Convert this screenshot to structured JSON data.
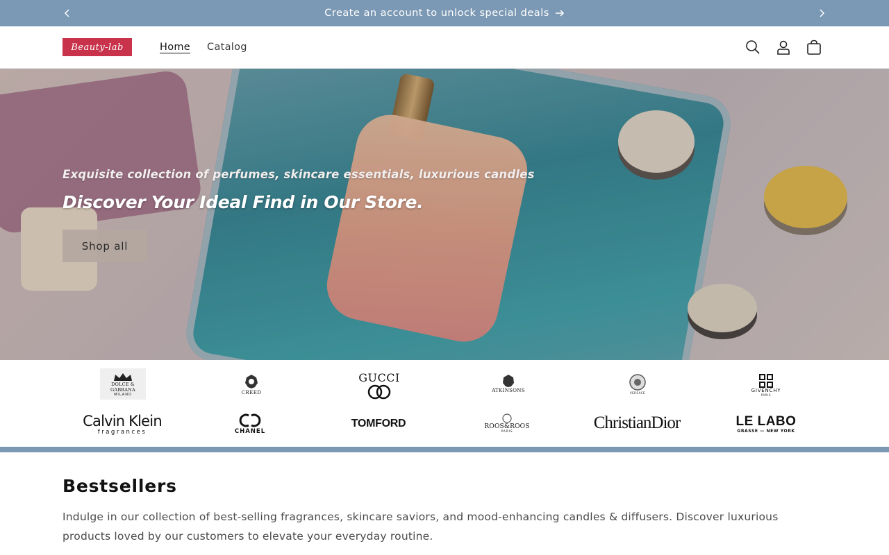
{
  "announcement": {
    "text": "Create an account to unlock special deals"
  },
  "header": {
    "logo_text": "Beauty-lab",
    "nav": [
      {
        "label": "Home",
        "active": true
      },
      {
        "label": "Catalog",
        "active": false
      }
    ],
    "icons": [
      "search-icon",
      "account-icon",
      "cart-icon"
    ]
  },
  "hero": {
    "subtitle": "Exquisite collection of perfumes, skincare essentials, luxurious candles",
    "title": "Discover Your Ideal Find in Our Store.",
    "button_label": "Shop all"
  },
  "brands": {
    "row1": [
      {
        "name": "DOLCE & GABBANA",
        "sub": "MILANO"
      },
      {
        "name": "CREED",
        "sub": ""
      },
      {
        "name": "GUCCI",
        "sub": ""
      },
      {
        "name": "ATKINSONS",
        "sub": ""
      },
      {
        "name": "VERSACE",
        "sub": ""
      },
      {
        "name": "GIVENCHY",
        "sub": "PARIS"
      }
    ],
    "row2": [
      {
        "name": "Calvin Klein",
        "sub": "fragrances"
      },
      {
        "name": "CHANEL",
        "sub": ""
      },
      {
        "name": "TOMFORD",
        "sub": ""
      },
      {
        "name": "ROOS&ROOS",
        "sub": "PARIS"
      },
      {
        "name": "ChristianDior",
        "sub": ""
      },
      {
        "name": "LE LABO",
        "sub": "GRASSE — NEW YORK"
      }
    ]
  },
  "bestsellers": {
    "title": "Bestsellers",
    "description": "Indulge in our collection of best-selling fragrances, skincare saviors, and mood-enhancing candles & diffusers. Discover luxurious products loved by our customers to elevate your everyday routine."
  },
  "colors": {
    "announcement_bg": "#7b99b4",
    "logo_bg": "#c8324a",
    "button_bg": "#b4a8a0"
  }
}
